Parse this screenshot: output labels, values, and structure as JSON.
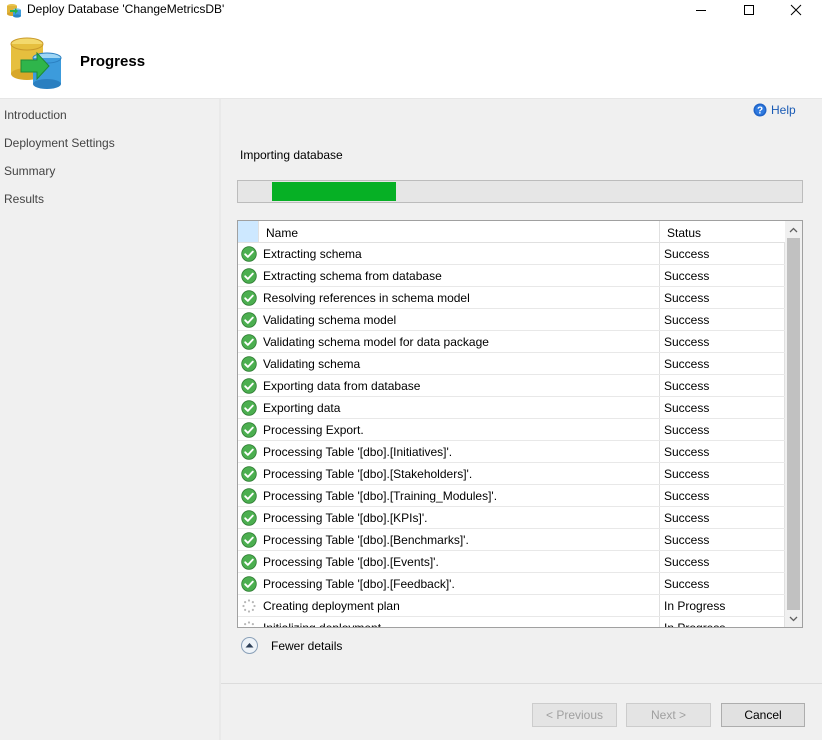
{
  "window": {
    "title": "Deploy Database 'ChangeMetricsDB'"
  },
  "header": {
    "title": "Progress"
  },
  "sidebar": {
    "items": [
      {
        "label": "Introduction"
      },
      {
        "label": "Deployment Settings"
      },
      {
        "label": "Summary"
      },
      {
        "label": "Results"
      }
    ]
  },
  "help": {
    "label": "Help"
  },
  "main": {
    "status_text": "Importing database",
    "progress": {
      "fraction": 0.22
    }
  },
  "grid": {
    "columns": [
      "Name",
      "Status"
    ],
    "rows": [
      {
        "name": "Extracting schema",
        "status": "Success",
        "icon": "success-check-icon"
      },
      {
        "name": "Extracting schema from database",
        "status": "Success",
        "icon": "success-check-icon"
      },
      {
        "name": "Resolving references in schema model",
        "status": "Success",
        "icon": "success-check-icon"
      },
      {
        "name": "Validating schema model",
        "status": "Success",
        "icon": "success-check-icon"
      },
      {
        "name": "Validating schema model for data package",
        "status": "Success",
        "icon": "success-check-icon"
      },
      {
        "name": "Validating schema",
        "status": "Success",
        "icon": "success-check-icon"
      },
      {
        "name": "Exporting data from database",
        "status": "Success",
        "icon": "success-check-icon"
      },
      {
        "name": "Exporting data",
        "status": "Success",
        "icon": "success-check-icon"
      },
      {
        "name": "Processing Export.",
        "status": "Success",
        "icon": "success-check-icon"
      },
      {
        "name": "Processing Table '[dbo].[Initiatives]'.",
        "status": "Success",
        "icon": "success-check-icon"
      },
      {
        "name": "Processing Table '[dbo].[Stakeholders]'.",
        "status": "Success",
        "icon": "success-check-icon"
      },
      {
        "name": "Processing Table '[dbo].[Training_Modules]'.",
        "status": "Success",
        "icon": "success-check-icon"
      },
      {
        "name": "Processing Table '[dbo].[KPIs]'.",
        "status": "Success",
        "icon": "success-check-icon"
      },
      {
        "name": "Processing Table '[dbo].[Benchmarks]'.",
        "status": "Success",
        "icon": "success-check-icon"
      },
      {
        "name": "Processing Table '[dbo].[Events]'.",
        "status": "Success",
        "icon": "success-check-icon"
      },
      {
        "name": "Processing Table '[dbo].[Feedback]'.",
        "status": "Success",
        "icon": "success-check-icon"
      },
      {
        "name": "Creating deployment plan",
        "status": "In Progress",
        "icon": "in-progress-spinner-icon"
      },
      {
        "name": "Initializing deployment",
        "status": "In Progress",
        "icon": "in-progress-spinner-icon"
      }
    ]
  },
  "details_toggle": {
    "label": "Fewer details"
  },
  "buttons": {
    "previous": "< Previous",
    "next": "Next >",
    "cancel": "Cancel"
  },
  "colors": {
    "progress_fill": "#06b025",
    "success": "#4caf50",
    "link": "#1a5bb5"
  }
}
